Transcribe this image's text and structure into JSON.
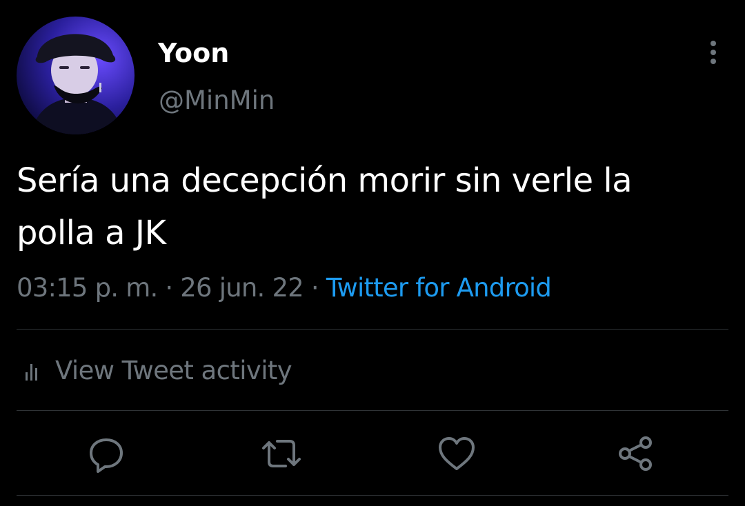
{
  "user": {
    "display_name": "Yoon",
    "handle": "@MinMin",
    "avatar_icon": "profile-photo"
  },
  "tweet": {
    "text": "Sería una decepción morir sin verle la polla a JK",
    "time": "03:15 p. m.",
    "separator": " · ",
    "date": "26 jun. 22",
    "source": "Twitter for Android"
  },
  "activity": {
    "label": "View Tweet activity",
    "icon": "bar-chart-icon"
  },
  "actions": [
    {
      "icon": "reply-icon"
    },
    {
      "icon": "retweet-icon"
    },
    {
      "icon": "like-icon"
    },
    {
      "icon": "share-icon"
    }
  ],
  "colors": {
    "background": "#000000",
    "primary_text": "#ffffff",
    "secondary_text": "#6e767d",
    "link": "#1d9bf0",
    "divider": "#2f3336"
  }
}
